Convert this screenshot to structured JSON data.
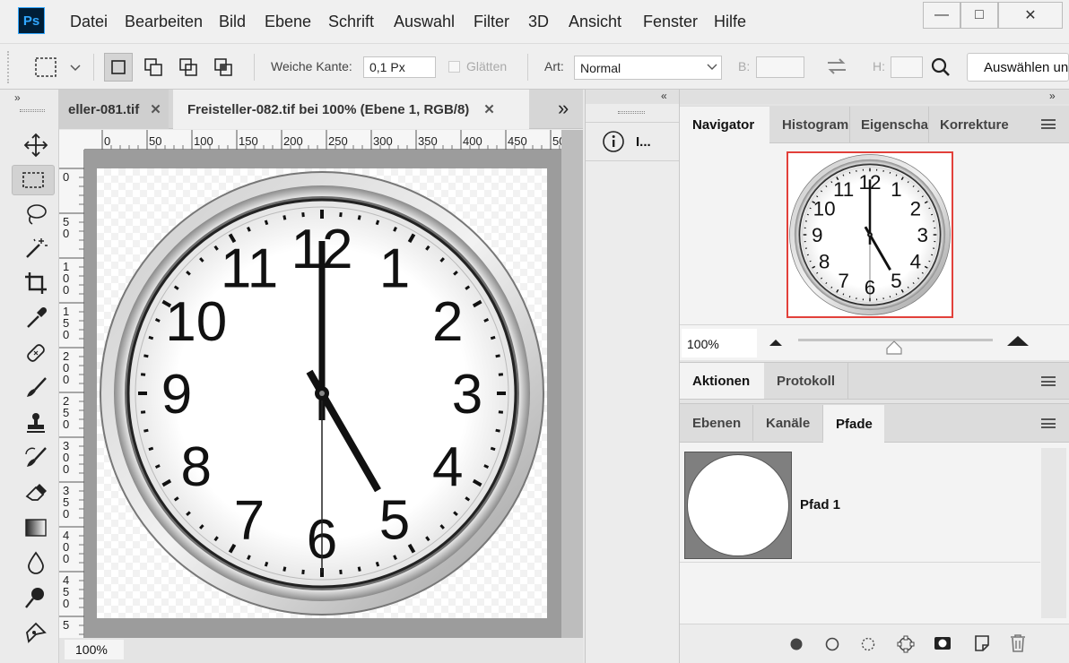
{
  "app": {
    "logo": "Ps"
  },
  "menu": [
    "Datei",
    "Bearbeiten",
    "Bild",
    "Ebene",
    "Schrift",
    "Auswahl",
    "Filter",
    "3D",
    "Ansicht",
    "Fenster",
    "Hilfe"
  ],
  "window_controls": {
    "minimize": "—",
    "maximize": "□",
    "close": "✕"
  },
  "options": {
    "feather_label": "Weiche Kante:",
    "feather_value": "0,1 Px",
    "antialias_label": "Glätten",
    "style_label": "Art:",
    "style_value": "Normal",
    "width_label": "B:",
    "height_label": "H:",
    "select_mask_button": "Auswählen un"
  },
  "document": {
    "tabs": [
      {
        "label": "eller-081.tif",
        "active": false
      },
      {
        "label": "Freisteller-082.tif bei 100% (Ebene 1, RGB/8)",
        "active": true
      }
    ],
    "tab_overflow": "»",
    "zoom": "100%",
    "ruler_top": [
      "0",
      "50",
      "100",
      "150",
      "200",
      "250",
      "300",
      "350",
      "400",
      "450",
      "50"
    ],
    "ruler_left": [
      [
        "0"
      ],
      [
        "5",
        "0"
      ],
      [
        "1",
        "0",
        "0"
      ],
      [
        "1",
        "5",
        "0"
      ],
      [
        "2",
        "0",
        "0"
      ],
      [
        "2",
        "5",
        "0"
      ],
      [
        "3",
        "0",
        "0"
      ],
      [
        "3",
        "5",
        "0"
      ],
      [
        "4",
        "0",
        "0"
      ],
      [
        "4",
        "5",
        "0"
      ],
      [
        "5"
      ]
    ]
  },
  "mini_panel": {
    "info_label": "I..."
  },
  "navigator": {
    "tabs": [
      "Navigator",
      "Histogram",
      "Eigenschaf",
      "Korrekture"
    ],
    "zoom": "100%"
  },
  "actions_panel": {
    "tabs": [
      "Aktionen",
      "Protokoll"
    ]
  },
  "layers_panel": {
    "tabs": [
      "Ebenen",
      "Kanäle",
      "Pfade"
    ],
    "paths": [
      {
        "name": "Pfad 1"
      }
    ]
  },
  "clock": {
    "numerals": [
      "12",
      "1",
      "2",
      "3",
      "4",
      "5",
      "6",
      "7",
      "8",
      "9",
      "10",
      "11"
    ],
    "time": "5:00"
  },
  "colors": {
    "accent": "#001e36",
    "brand": "#31a8ff",
    "navigator_frame": "#e2403a"
  }
}
